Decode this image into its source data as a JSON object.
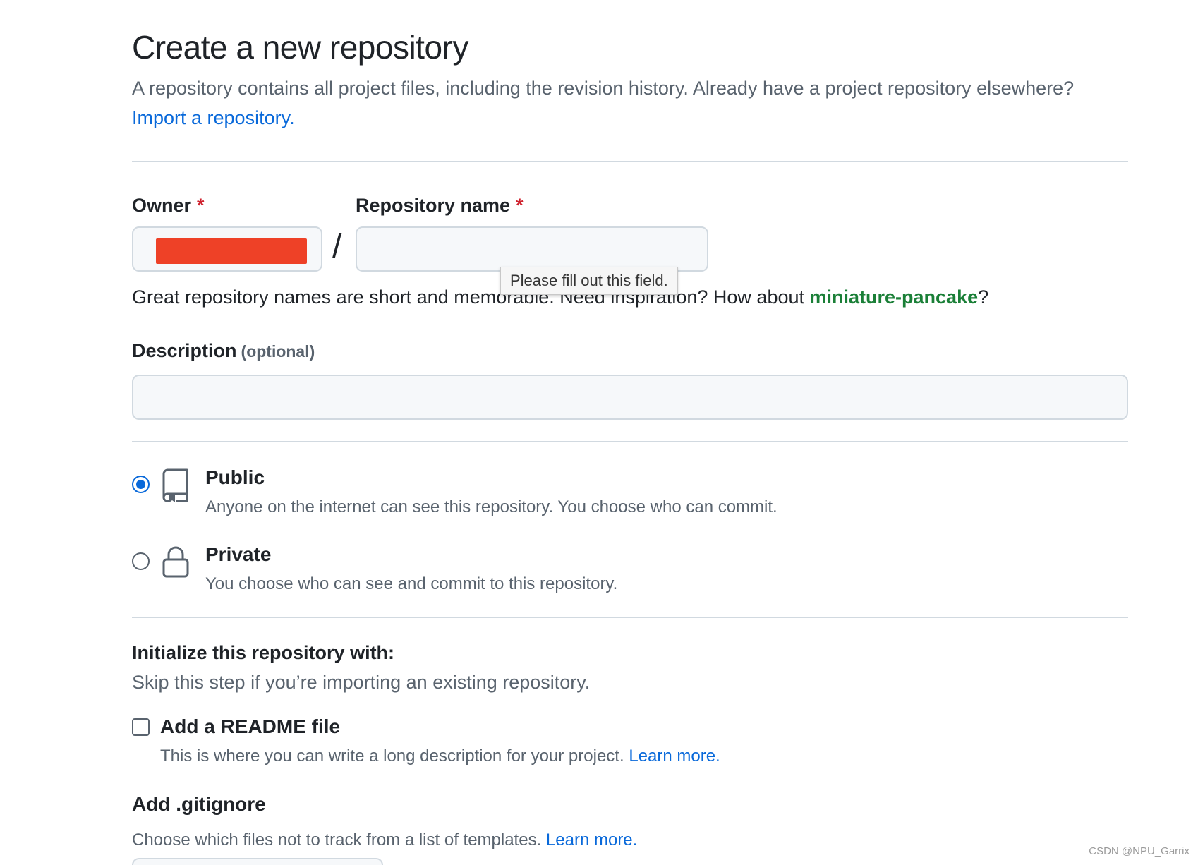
{
  "header": {
    "title": "Create a new repository",
    "subtitle": "A repository contains all project files, including the revision history. Already have a project repository elsewhere?",
    "import_link": "Import a repository."
  },
  "owner": {
    "label": "Owner",
    "required_mark": "*"
  },
  "separator": "/",
  "repo_name": {
    "label": "Repository name",
    "required_mark": "*",
    "value": "",
    "tooltip": "Please fill out this field.",
    "hint_prefix": "Great repository names are short and memorable. Need inspiration? How about",
    "suggestion": "miniature-pancake",
    "hint_suffix": "?"
  },
  "description": {
    "label": "Description",
    "optional": "(optional)",
    "value": ""
  },
  "visibility": {
    "options": [
      {
        "title": "Public",
        "desc": "Anyone on the internet can see this repository. You choose who can commit.",
        "icon": "repo-icon",
        "selected": true
      },
      {
        "title": "Private",
        "desc": "You choose who can see and commit to this repository.",
        "icon": "lock-icon",
        "selected": false
      }
    ]
  },
  "initialize": {
    "title": "Initialize this repository with:",
    "subtitle": "Skip this step if you’re importing an existing repository.",
    "readme": {
      "label": "Add a README file",
      "desc": "This is where you can write a long description for your project.",
      "learn_more": "Learn more.",
      "checked": false
    },
    "gitignore": {
      "label": "Add .gitignore",
      "desc": "Choose which files not to track from a list of templates.",
      "learn_more": "Learn more."
    }
  },
  "watermark": "CSDN @NPU_Garrix",
  "colors": {
    "accent": "#0969da",
    "required": "#cf222e",
    "suggestion": "#1a7f37",
    "redaction": "#ee4127"
  }
}
